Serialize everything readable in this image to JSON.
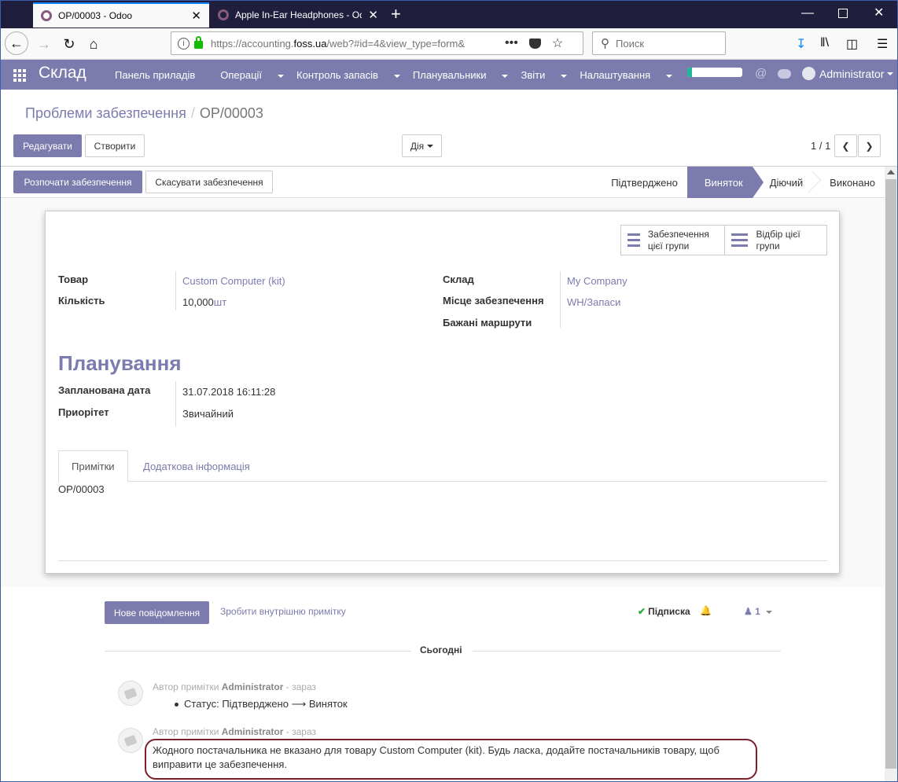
{
  "browser": {
    "tabs": [
      {
        "title": "OP/00003 - Odoo",
        "active": true
      },
      {
        "title": "Apple In-Ear Headphones - Odoo",
        "active": false
      }
    ],
    "url_prefix": "https://accounting.",
    "url_domain": "foss.ua",
    "url_suffix": "/web?#id=4&view_type=form&",
    "search_placeholder": "Поиск"
  },
  "topmenu": {
    "brand": "Склад",
    "items": [
      "Панель приладів",
      "Операції",
      "Контроль запасів",
      "Планувальники",
      "Звіти",
      "Налаштування"
    ],
    "user": "Administrator",
    "progress": 0.08
  },
  "breadcrumb": {
    "parent": "Проблеми забезпечення",
    "current": "OP/00003"
  },
  "buttons": {
    "edit": "Редагувати",
    "create": "Створити",
    "action": "Дія",
    "run": "Розпочати забезпечення",
    "cancel": "Скасувати забезпечення"
  },
  "pager": "1 / 1",
  "stages": [
    "Підтверджено",
    "Виняток",
    "Діючий",
    "Виконано"
  ],
  "current_stage": "Виняток",
  "smart_buttons": [
    "Забезпечення цієї групи",
    "Відбір цієї групи"
  ],
  "fields": {
    "product_label": "Товар",
    "product_value": "Custom Computer (kit)",
    "qty_label": "Кількість",
    "qty_value": "10,000",
    "qty_uom": "шт",
    "warehouse_label": "Склад",
    "warehouse_value": "My Company",
    "location_label": "Місце забезпечення",
    "location_value": "WH/Запаси",
    "routes_label": "Бажані маршрути"
  },
  "planning": {
    "title": "Планування",
    "date_label": "Запланована дата",
    "date_value": "31.07.2018 16:11:28",
    "priority_label": "Приорітет",
    "priority_value": "Звичайний"
  },
  "notebook": {
    "tabs": [
      "Примітки",
      "Додаткова інформація"
    ],
    "content": "OP/00003"
  },
  "chatter": {
    "new_message": "Нове повідомлення",
    "log_note": "Зробити внутрішню примітку",
    "follow": "Підписка",
    "followers": "1",
    "today": "Сьогодні",
    "messages": [
      {
        "prefix": "Автор примітки",
        "author": "Administrator",
        "time": "- зараз",
        "body_prefix": "Статус: Підтверджено",
        "body_arrow": "⟶",
        "body_suffix": "Виняток"
      },
      {
        "prefix": "Автор примітки",
        "author": "Administrator",
        "time": "- зараз",
        "line1": "Жодного постачальника не вказано для товару Custom Computer (kit). Будь ласка, додайте постачальників товару, щоб",
        "line2": "виправити це забезпечення."
      }
    ]
  }
}
